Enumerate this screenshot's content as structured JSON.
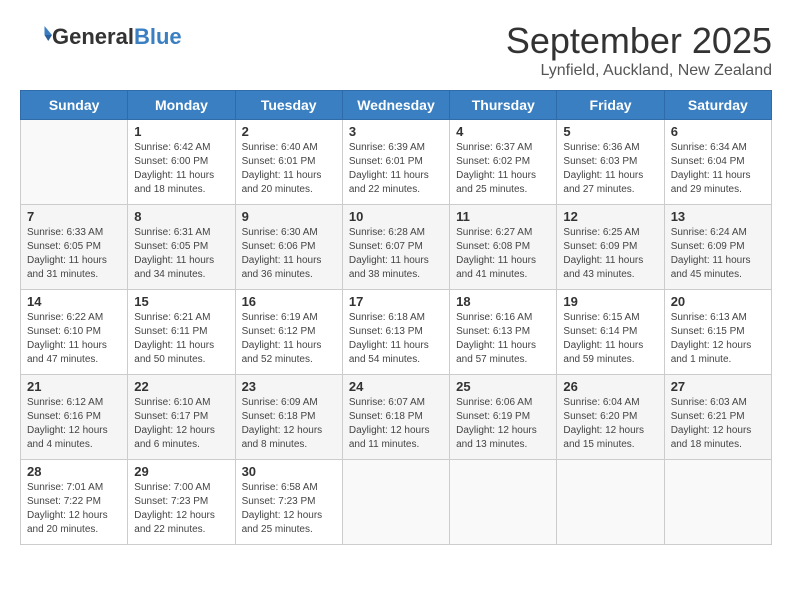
{
  "logo": {
    "general": "General",
    "blue": "Blue"
  },
  "title": "September 2025",
  "location": "Lynfield, Auckland, New Zealand",
  "days": [
    "Sunday",
    "Monday",
    "Tuesday",
    "Wednesday",
    "Thursday",
    "Friday",
    "Saturday"
  ],
  "weeks": [
    [
      {
        "date": "",
        "sunrise": "",
        "sunset": "",
        "daylight": ""
      },
      {
        "date": "1",
        "sunrise": "Sunrise: 6:42 AM",
        "sunset": "Sunset: 6:00 PM",
        "daylight": "Daylight: 11 hours and 18 minutes."
      },
      {
        "date": "2",
        "sunrise": "Sunrise: 6:40 AM",
        "sunset": "Sunset: 6:01 PM",
        "daylight": "Daylight: 11 hours and 20 minutes."
      },
      {
        "date": "3",
        "sunrise": "Sunrise: 6:39 AM",
        "sunset": "Sunset: 6:01 PM",
        "daylight": "Daylight: 11 hours and 22 minutes."
      },
      {
        "date": "4",
        "sunrise": "Sunrise: 6:37 AM",
        "sunset": "Sunset: 6:02 PM",
        "daylight": "Daylight: 11 hours and 25 minutes."
      },
      {
        "date": "5",
        "sunrise": "Sunrise: 6:36 AM",
        "sunset": "Sunset: 6:03 PM",
        "daylight": "Daylight: 11 hours and 27 minutes."
      },
      {
        "date": "6",
        "sunrise": "Sunrise: 6:34 AM",
        "sunset": "Sunset: 6:04 PM",
        "daylight": "Daylight: 11 hours and 29 minutes."
      }
    ],
    [
      {
        "date": "7",
        "sunrise": "Sunrise: 6:33 AM",
        "sunset": "Sunset: 6:05 PM",
        "daylight": "Daylight: 11 hours and 31 minutes."
      },
      {
        "date": "8",
        "sunrise": "Sunrise: 6:31 AM",
        "sunset": "Sunset: 6:05 PM",
        "daylight": "Daylight: 11 hours and 34 minutes."
      },
      {
        "date": "9",
        "sunrise": "Sunrise: 6:30 AM",
        "sunset": "Sunset: 6:06 PM",
        "daylight": "Daylight: 11 hours and 36 minutes."
      },
      {
        "date": "10",
        "sunrise": "Sunrise: 6:28 AM",
        "sunset": "Sunset: 6:07 PM",
        "daylight": "Daylight: 11 hours and 38 minutes."
      },
      {
        "date": "11",
        "sunrise": "Sunrise: 6:27 AM",
        "sunset": "Sunset: 6:08 PM",
        "daylight": "Daylight: 11 hours and 41 minutes."
      },
      {
        "date": "12",
        "sunrise": "Sunrise: 6:25 AM",
        "sunset": "Sunset: 6:09 PM",
        "daylight": "Daylight: 11 hours and 43 minutes."
      },
      {
        "date": "13",
        "sunrise": "Sunrise: 6:24 AM",
        "sunset": "Sunset: 6:09 PM",
        "daylight": "Daylight: 11 hours and 45 minutes."
      }
    ],
    [
      {
        "date": "14",
        "sunrise": "Sunrise: 6:22 AM",
        "sunset": "Sunset: 6:10 PM",
        "daylight": "Daylight: 11 hours and 47 minutes."
      },
      {
        "date": "15",
        "sunrise": "Sunrise: 6:21 AM",
        "sunset": "Sunset: 6:11 PM",
        "daylight": "Daylight: 11 hours and 50 minutes."
      },
      {
        "date": "16",
        "sunrise": "Sunrise: 6:19 AM",
        "sunset": "Sunset: 6:12 PM",
        "daylight": "Daylight: 11 hours and 52 minutes."
      },
      {
        "date": "17",
        "sunrise": "Sunrise: 6:18 AM",
        "sunset": "Sunset: 6:13 PM",
        "daylight": "Daylight: 11 hours and 54 minutes."
      },
      {
        "date": "18",
        "sunrise": "Sunrise: 6:16 AM",
        "sunset": "Sunset: 6:13 PM",
        "daylight": "Daylight: 11 hours and 57 minutes."
      },
      {
        "date": "19",
        "sunrise": "Sunrise: 6:15 AM",
        "sunset": "Sunset: 6:14 PM",
        "daylight": "Daylight: 11 hours and 59 minutes."
      },
      {
        "date": "20",
        "sunrise": "Sunrise: 6:13 AM",
        "sunset": "Sunset: 6:15 PM",
        "daylight": "Daylight: 12 hours and 1 minute."
      }
    ],
    [
      {
        "date": "21",
        "sunrise": "Sunrise: 6:12 AM",
        "sunset": "Sunset: 6:16 PM",
        "daylight": "Daylight: 12 hours and 4 minutes."
      },
      {
        "date": "22",
        "sunrise": "Sunrise: 6:10 AM",
        "sunset": "Sunset: 6:17 PM",
        "daylight": "Daylight: 12 hours and 6 minutes."
      },
      {
        "date": "23",
        "sunrise": "Sunrise: 6:09 AM",
        "sunset": "Sunset: 6:18 PM",
        "daylight": "Daylight: 12 hours and 8 minutes."
      },
      {
        "date": "24",
        "sunrise": "Sunrise: 6:07 AM",
        "sunset": "Sunset: 6:18 PM",
        "daylight": "Daylight: 12 hours and 11 minutes."
      },
      {
        "date": "25",
        "sunrise": "Sunrise: 6:06 AM",
        "sunset": "Sunset: 6:19 PM",
        "daylight": "Daylight: 12 hours and 13 minutes."
      },
      {
        "date": "26",
        "sunrise": "Sunrise: 6:04 AM",
        "sunset": "Sunset: 6:20 PM",
        "daylight": "Daylight: 12 hours and 15 minutes."
      },
      {
        "date": "27",
        "sunrise": "Sunrise: 6:03 AM",
        "sunset": "Sunset: 6:21 PM",
        "daylight": "Daylight: 12 hours and 18 minutes."
      }
    ],
    [
      {
        "date": "28",
        "sunrise": "Sunrise: 7:01 AM",
        "sunset": "Sunset: 7:22 PM",
        "daylight": "Daylight: 12 hours and 20 minutes."
      },
      {
        "date": "29",
        "sunrise": "Sunrise: 7:00 AM",
        "sunset": "Sunset: 7:23 PM",
        "daylight": "Daylight: 12 hours and 22 minutes."
      },
      {
        "date": "30",
        "sunrise": "Sunrise: 6:58 AM",
        "sunset": "Sunset: 7:23 PM",
        "daylight": "Daylight: 12 hours and 25 minutes."
      },
      {
        "date": "",
        "sunrise": "",
        "sunset": "",
        "daylight": ""
      },
      {
        "date": "",
        "sunrise": "",
        "sunset": "",
        "daylight": ""
      },
      {
        "date": "",
        "sunrise": "",
        "sunset": "",
        "daylight": ""
      },
      {
        "date": "",
        "sunrise": "",
        "sunset": "",
        "daylight": ""
      }
    ]
  ]
}
